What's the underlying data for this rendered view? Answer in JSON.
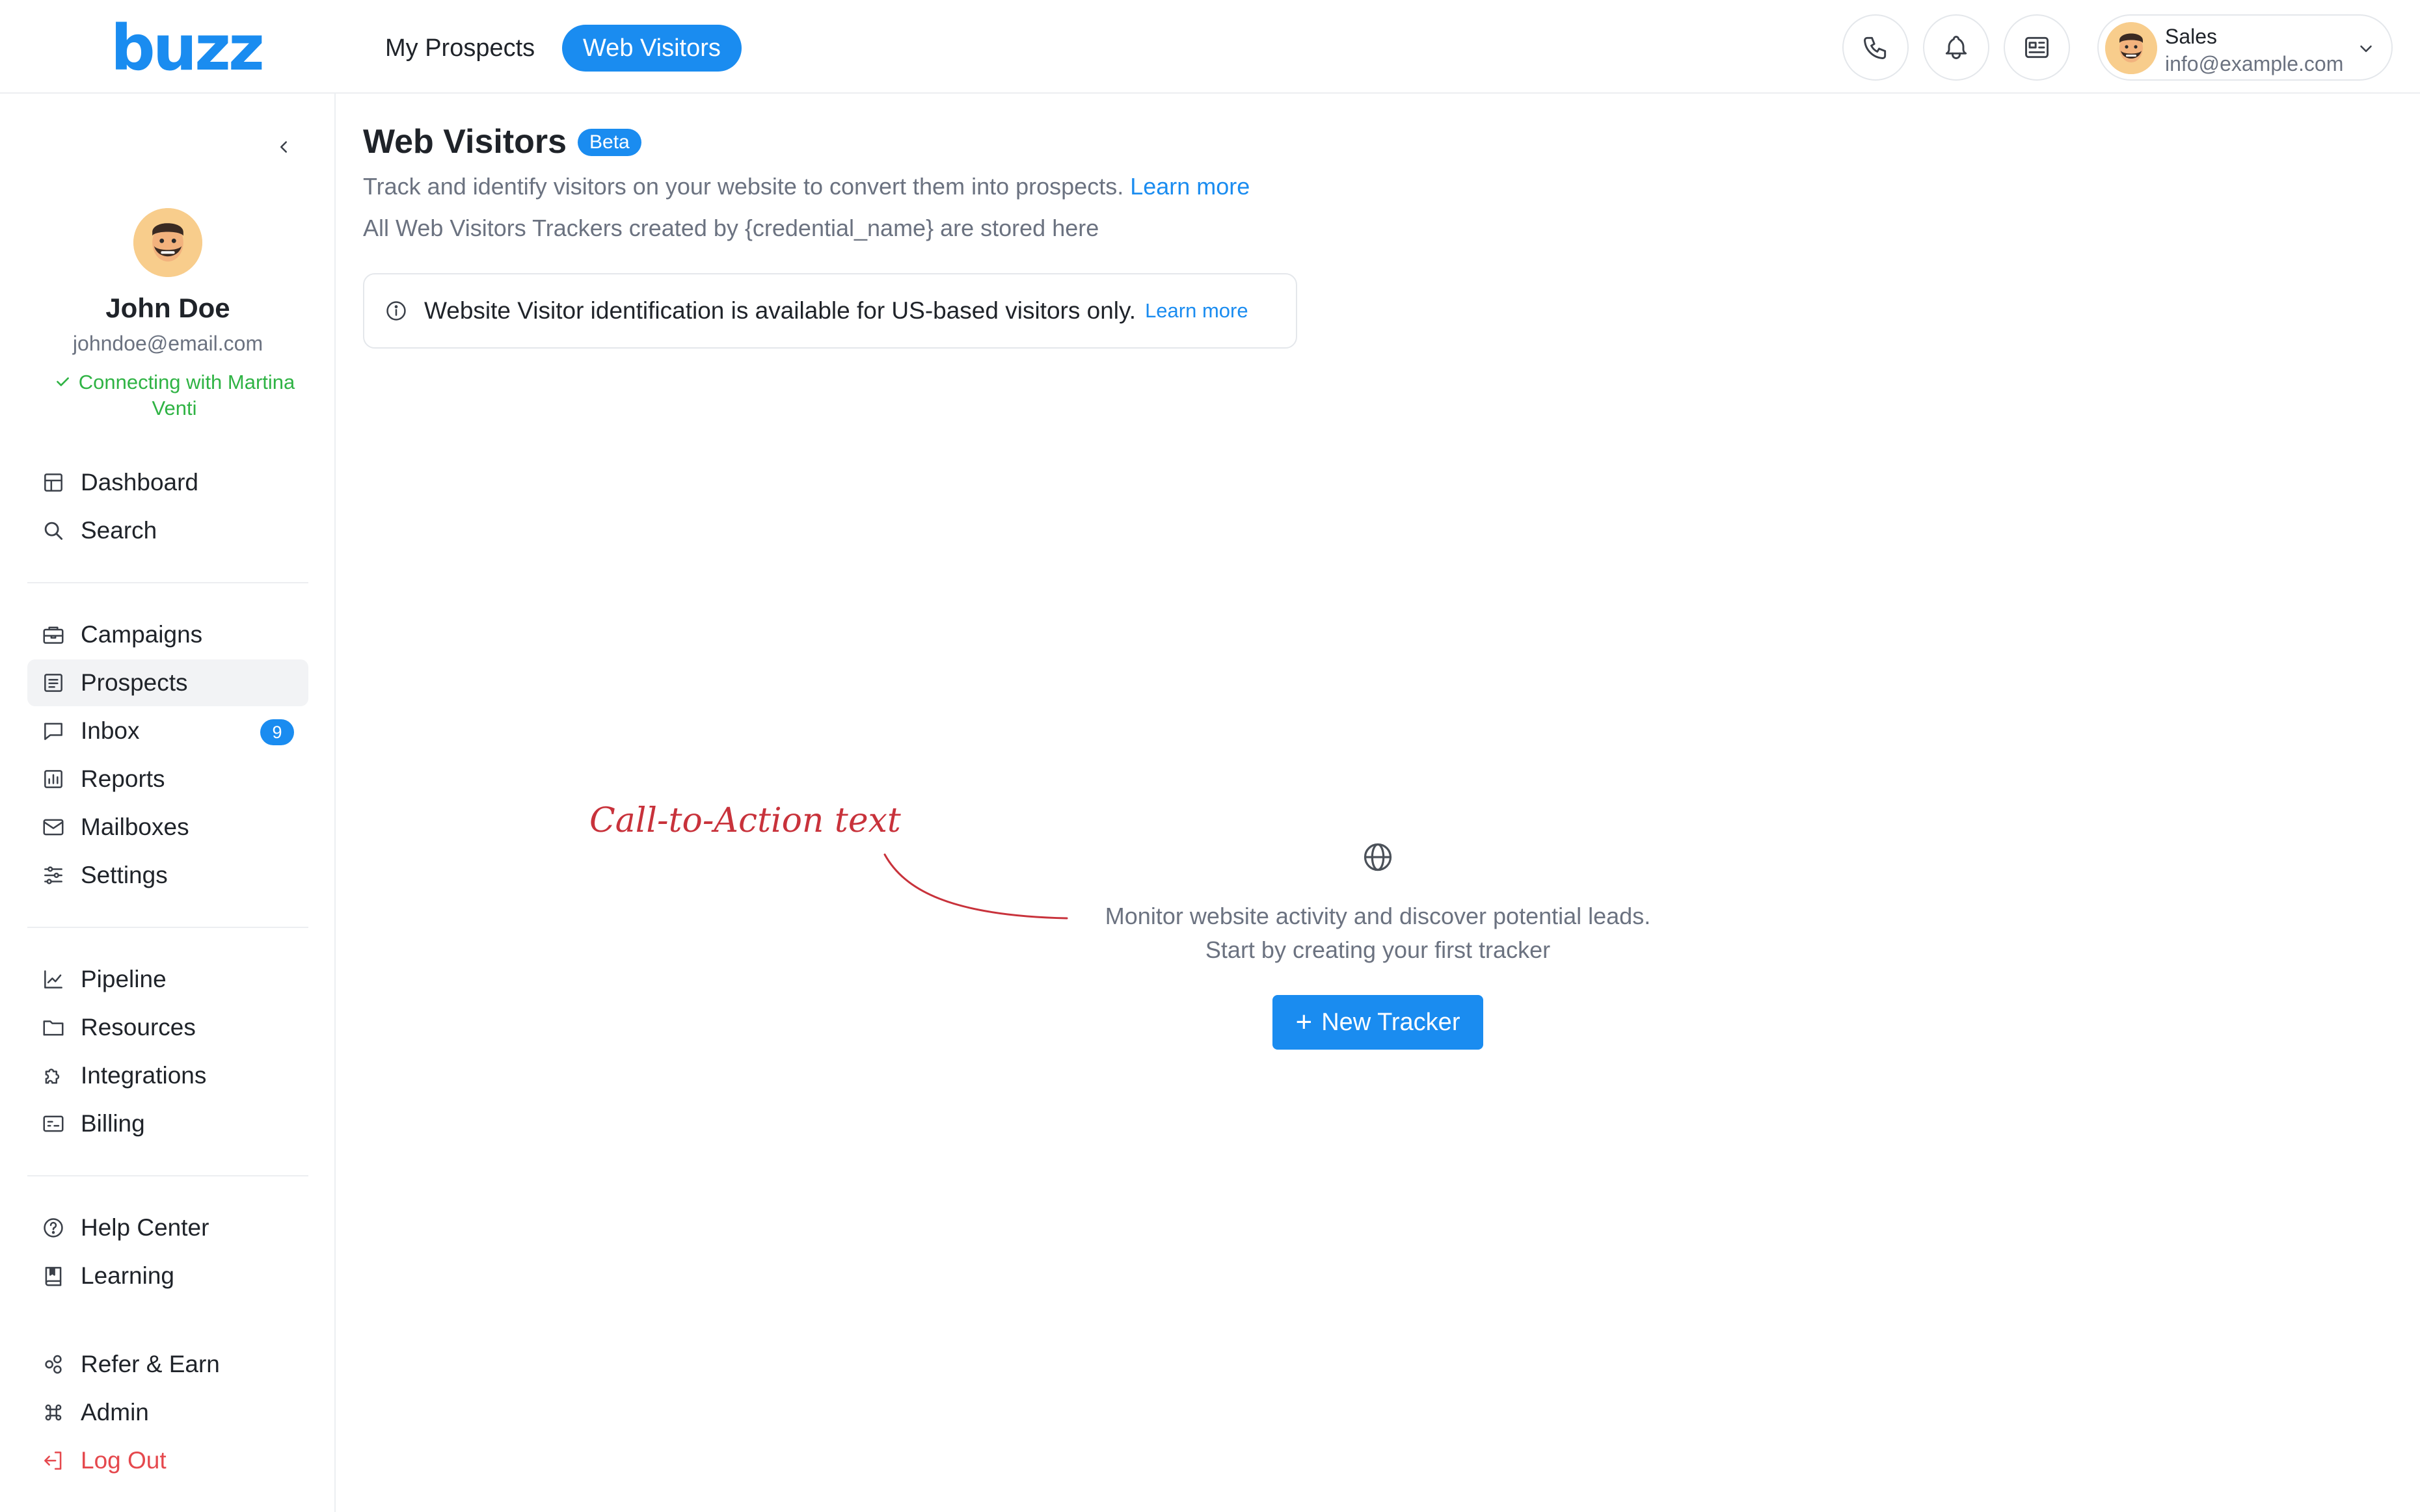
{
  "brand": {
    "logo_text": "buzz",
    "accent": "#1a8cf0"
  },
  "top_nav": {
    "tabs": [
      {
        "label": "My Prospects",
        "active": false
      },
      {
        "label": "Web Visitors",
        "active": true
      }
    ],
    "icons": [
      "phone-icon",
      "bell-icon",
      "news-icon"
    ],
    "account": {
      "role": "Sales",
      "email": "info@example.com"
    }
  },
  "sidebar": {
    "user": {
      "name": "John Doe",
      "email": "johndoe@email.com",
      "status": "Connecting with Martina Venti",
      "status_color": "#2fb344"
    },
    "groups": [
      [
        {
          "label": "Dashboard",
          "icon": "layout-icon"
        },
        {
          "label": "Search",
          "icon": "search-icon"
        }
      ],
      [
        {
          "label": "Campaigns",
          "icon": "briefcase-icon"
        },
        {
          "label": "Prospects",
          "icon": "list-icon",
          "active": true
        },
        {
          "label": "Inbox",
          "icon": "chat-icon",
          "badge": "9"
        },
        {
          "label": "Reports",
          "icon": "chart-icon"
        },
        {
          "label": "Mailboxes",
          "icon": "mail-icon"
        },
        {
          "label": "Settings",
          "icon": "sliders-icon"
        }
      ],
      [
        {
          "label": "Pipeline",
          "icon": "trend-icon"
        },
        {
          "label": "Resources",
          "icon": "folder-icon"
        },
        {
          "label": "Integrations",
          "icon": "puzzle-icon"
        },
        {
          "label": "Billing",
          "icon": "billing-icon"
        }
      ],
      [
        {
          "label": "Help Center",
          "icon": "help-icon"
        },
        {
          "label": "Learning",
          "icon": "book-icon"
        }
      ],
      [
        {
          "label": "Refer & Earn",
          "icon": "share-icon"
        },
        {
          "label": "Admin",
          "icon": "command-icon"
        },
        {
          "label": "Log Out",
          "icon": "logout-icon",
          "danger": true
        }
      ]
    ]
  },
  "main": {
    "title": "Web Visitors",
    "badge": "Beta",
    "subtitle": "Track and identify visitors on your website to convert them into prospects.",
    "subtitle_link": "Learn more",
    "subtitle2": "All Web Visitors Trackers created by {credential_name} are stored here",
    "notice": {
      "text": "Website Visitor identification is available for US-based visitors only.",
      "link": "Learn more"
    },
    "empty_state": {
      "icon": "globe-icon",
      "line1": "Monitor website activity and discover potential leads.",
      "line2": "Start by creating your first tracker",
      "button": "New Tracker"
    },
    "annotation": {
      "text": "Call-to-Action text",
      "color": "#c8323b"
    }
  }
}
